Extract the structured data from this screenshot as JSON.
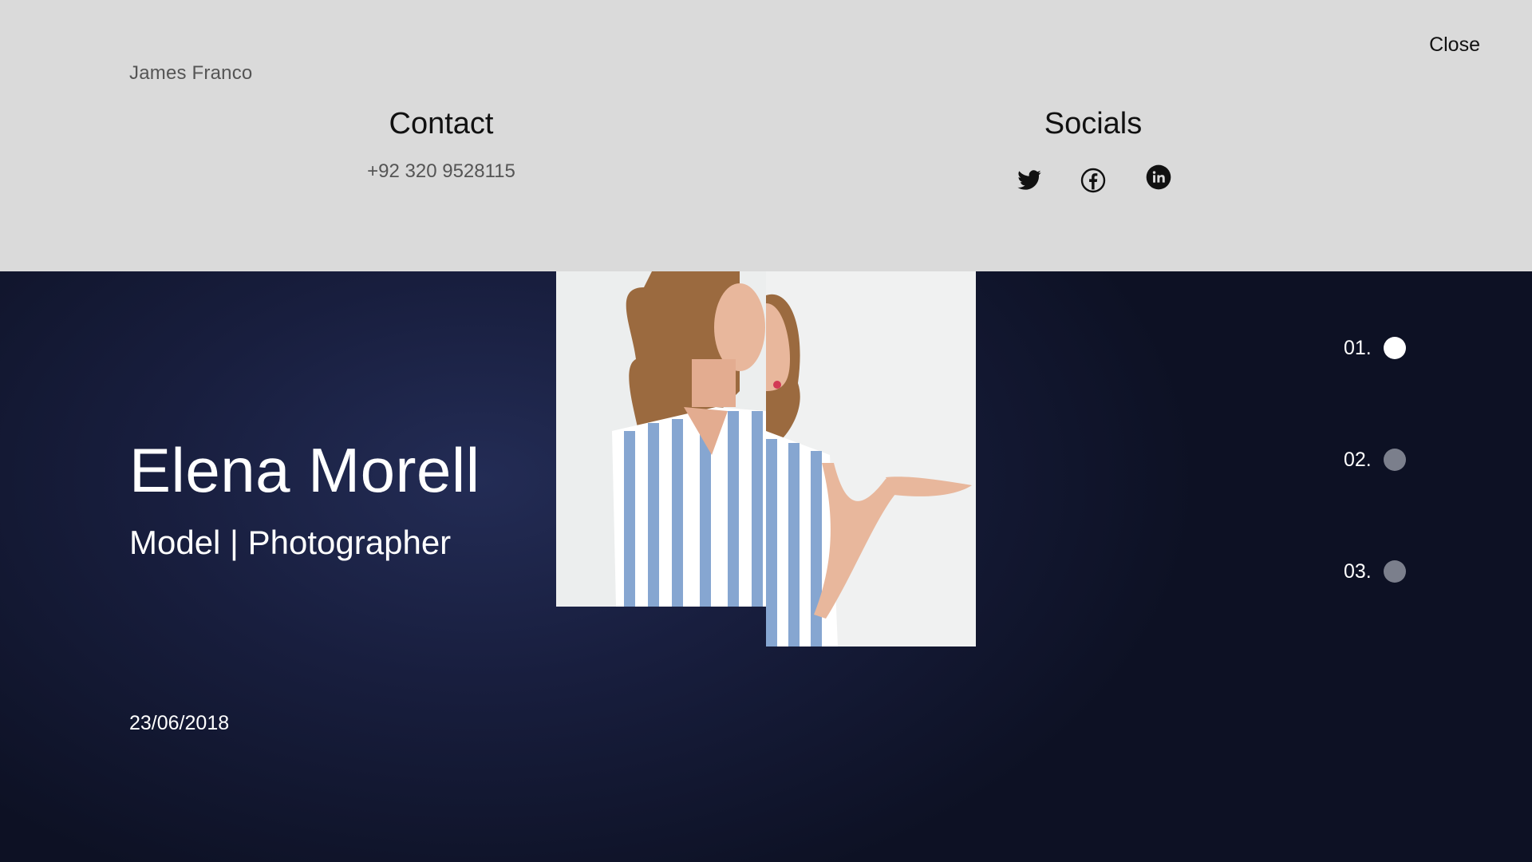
{
  "header": {
    "brand_name": "James Franco",
    "close_label": "Close"
  },
  "contact": {
    "title": "Contact",
    "phone": "+92 320 9528115"
  },
  "socials": {
    "title": "Socials",
    "icons": [
      "twitter-icon",
      "facebook-icon",
      "linkedin-icon"
    ]
  },
  "hero": {
    "name": "Elena Morell",
    "subtitle": "Model | Photographer",
    "date": "23/06/2018"
  },
  "slides": [
    {
      "label": "01.",
      "active": true
    },
    {
      "label": "02.",
      "active": false
    },
    {
      "label": "03.",
      "active": false
    }
  ],
  "colors": {
    "top_panel_bg": "#dadada",
    "hero_bg": "#181e3e",
    "active_dot": "#ffffff",
    "inactive_dot": "#7b7f8c"
  }
}
